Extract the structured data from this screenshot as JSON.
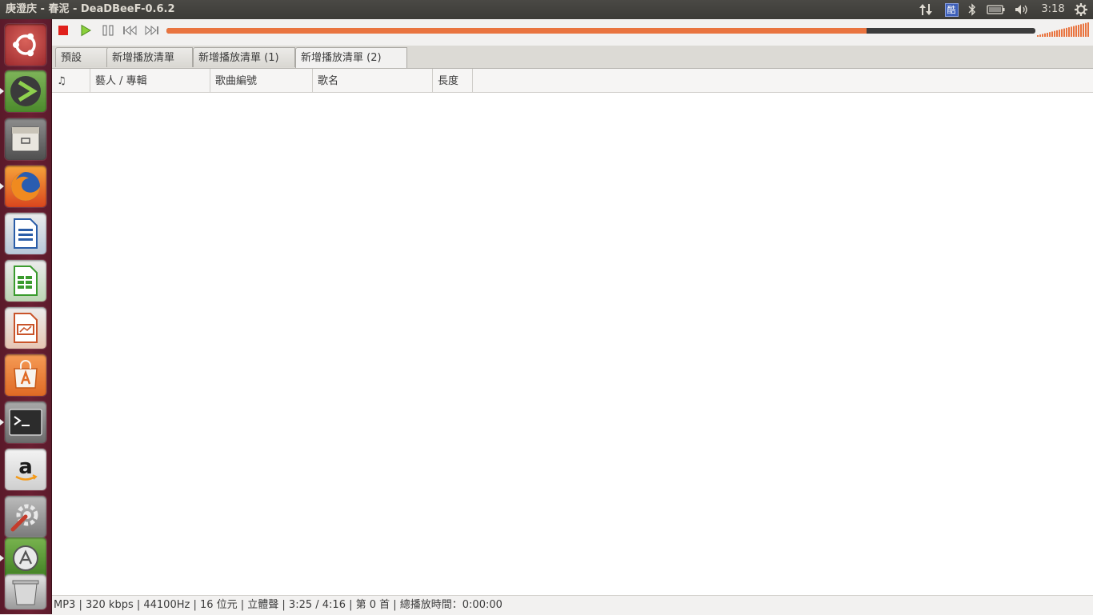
{
  "window": {
    "title": "庚澄庆 - 春泥 - DeaDBeeF-0.6.2"
  },
  "tray": {
    "ime_label": "酷",
    "clock": "3:18"
  },
  "launcher": {
    "items": [
      {
        "name": "ubuntu-dash"
      },
      {
        "name": "deadbeef"
      },
      {
        "name": "files"
      },
      {
        "name": "firefox"
      },
      {
        "name": "libreoffice-writer"
      },
      {
        "name": "libreoffice-calc"
      },
      {
        "name": "libreoffice-impress"
      },
      {
        "name": "ubuntu-software-center"
      },
      {
        "name": "terminal"
      },
      {
        "name": "amazon"
      },
      {
        "name": "system-settings"
      },
      {
        "name": "software-updater"
      },
      {
        "name": "trash"
      }
    ]
  },
  "player": {
    "progress": 0.806,
    "volume_level": 1.0
  },
  "tabs": [
    {
      "label": "預設"
    },
    {
      "label": "新增播放清單"
    },
    {
      "label": "新增播放清單 (1)"
    },
    {
      "label": "新增播放清單 (2)",
      "active": true
    }
  ],
  "columns": [
    {
      "label": "♫"
    },
    {
      "label": "藝人 / 專輯"
    },
    {
      "label": "歌曲編號"
    },
    {
      "label": "歌名"
    },
    {
      "label": "長度"
    }
  ],
  "status": {
    "text": "MP3 |  320 kbps | 44100Hz | 16 位元 | 立體聲 | 3:25 / 4:16 | 第 0 首 | 總播放時間：0:00:00"
  },
  "colors": {
    "accent": "#e9743f",
    "launcher": "#6a1f32",
    "panel": "#3c3b37"
  }
}
